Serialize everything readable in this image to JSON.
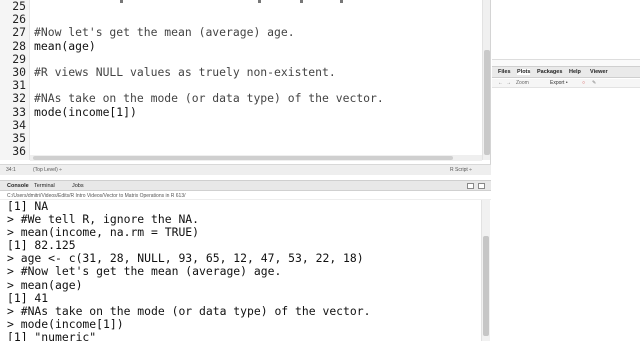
{
  "editor": {
    "line_numbers": [
      "25",
      "26",
      "27",
      "28",
      "29",
      "30",
      "31",
      "32",
      "33",
      "34",
      "35",
      "36"
    ],
    "lines": [
      "",
      "",
      "#Now let's get the mean (average) age.",
      "mean(age)",
      "",
      "#R views NULL values as truely non-existent.",
      "",
      "#NAs take on the mode (or data type) of the vector.",
      "mode(income[1])",
      "",
      "",
      ""
    ],
    "status": {
      "position": "34:1",
      "scope": "(Top Level) ÷",
      "file_type": "R Script ÷"
    }
  },
  "right_pane": {
    "tabs": [
      "Files",
      "Plots",
      "Packages",
      "Help",
      "Viewer"
    ],
    "toolbar": [
      "Zoom",
      "Export •"
    ]
  },
  "console": {
    "tabs": [
      "Console",
      "Terminal",
      "Jobs"
    ],
    "path": "C:/Users/dmitri/Videos/Edits/R Intro Videos/Vector to Matrix Operations in R 613/",
    "lines": [
      "[1] NA",
      "> #We tell R, ignore the NA.",
      "> mean(income, na.rm = TRUE)",
      "[1] 82.125",
      "> age <- c(31, 28, NULL, 93, 65, 12, 47, 53, 22, 18)",
      "> #Now let's get the mean (average) age.",
      "> mean(age)",
      "[1] 41",
      "> #NAs take on the mode (or data type) of the vector.",
      "> mode(income[1])",
      "[1] \"numeric\"",
      "> "
    ]
  }
}
